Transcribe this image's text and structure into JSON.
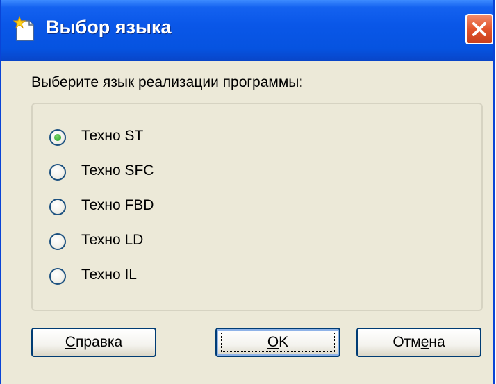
{
  "window": {
    "title": "Выбор языка",
    "icon": "new-document-icon"
  },
  "prompt": "Выберите язык реализации программы:",
  "options": [
    {
      "label": "Техно ST",
      "selected": true
    },
    {
      "label": "Техно SFC",
      "selected": false
    },
    {
      "label": "Техно FBD",
      "selected": false
    },
    {
      "label": "Техно LD",
      "selected": false
    },
    {
      "label": "Техно IL",
      "selected": false
    }
  ],
  "buttons": {
    "help": {
      "mnemonic": "С",
      "rest": "правка"
    },
    "ok": {
      "mnemonic": "О",
      "rest": "K"
    },
    "cancel": {
      "before": "Отм",
      "mnemonic": "е",
      "after": "на"
    }
  },
  "colors": {
    "titlebar": "#0a57e8",
    "close": "#e2542b",
    "dialog_bg": "#ece9d8",
    "radio_dot": "#21a121"
  }
}
